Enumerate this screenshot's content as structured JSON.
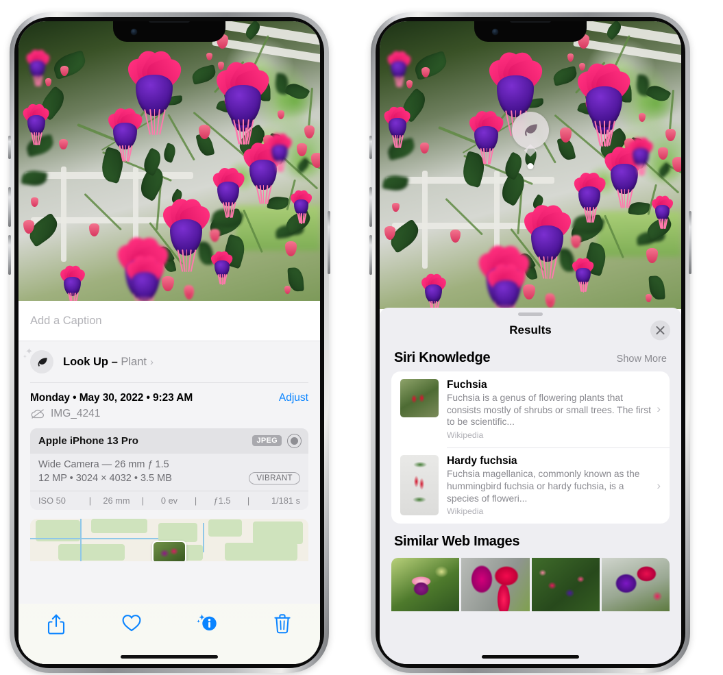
{
  "left_phone": {
    "screen_name": "photos-info-screen",
    "caption": {
      "placeholder": "Add a Caption",
      "value": ""
    },
    "lookup": {
      "icon": "leaf-icon",
      "label": "Look Up",
      "dash": " – ",
      "subject": "Plant",
      "chevron": "›"
    },
    "metadata": {
      "datetime": "Monday • May 30, 2022 • 9:23 AM",
      "adjust_label": "Adjust",
      "cloud_icon": "cloud-slash-icon",
      "filename": "IMG_4241"
    },
    "exif": {
      "device": "Apple iPhone 13 Pro",
      "format_badge": "JPEG",
      "lens_icon": "lens-icon",
      "lens_line": "Wide Camera — 26 mm ƒ 1.5",
      "size_line": "12 MP • 3024 × 4032 • 3.5 MB",
      "style_badge": "VIBRANT",
      "stats": [
        "ISO 50",
        "26 mm",
        "0 ev",
        "ƒ1.5",
        "1/181 s"
      ]
    },
    "map": {
      "pin_label": "photo-location-pin"
    },
    "toolbar": [
      {
        "name": "share-button",
        "icon": "share-icon"
      },
      {
        "name": "favorite-button",
        "icon": "heart-icon"
      },
      {
        "name": "info-button",
        "icon": "info-sparkle-icon"
      },
      {
        "name": "delete-button",
        "icon": "trash-icon"
      }
    ],
    "accent_color": "#0a84ff"
  },
  "right_phone": {
    "screen_name": "visual-lookup-results-screen",
    "badge": {
      "icon": "leaf-icon",
      "name": "visual-lookup-badge"
    },
    "sheet": {
      "title": "Results",
      "close_icon": "close-icon",
      "grabber": "sheet-grabber"
    },
    "siri_knowledge": {
      "section_title": "Siri Knowledge",
      "show_more": "Show More",
      "items": [
        {
          "title": "Fuchsia",
          "description": "Fuchsia is a genus of flowering plants that consists mostly of shrubs or small trees. The first to be scientific...",
          "source": "Wikipedia",
          "chevron": "›"
        },
        {
          "title": "Hardy fuchsia",
          "description": "Fuchsia magellanica, commonly known as the hummingbird fuchsia or hardy fuchsia, is a species of floweri...",
          "source": "Wikipedia",
          "chevron": "›"
        }
      ]
    },
    "similar_web_images": {
      "section_title": "Similar Web Images",
      "thumbnails": [
        "fuchsia-web-image-1",
        "fuchsia-web-image-2",
        "fuchsia-web-image-3",
        "fuchsia-web-image-4"
      ]
    }
  }
}
